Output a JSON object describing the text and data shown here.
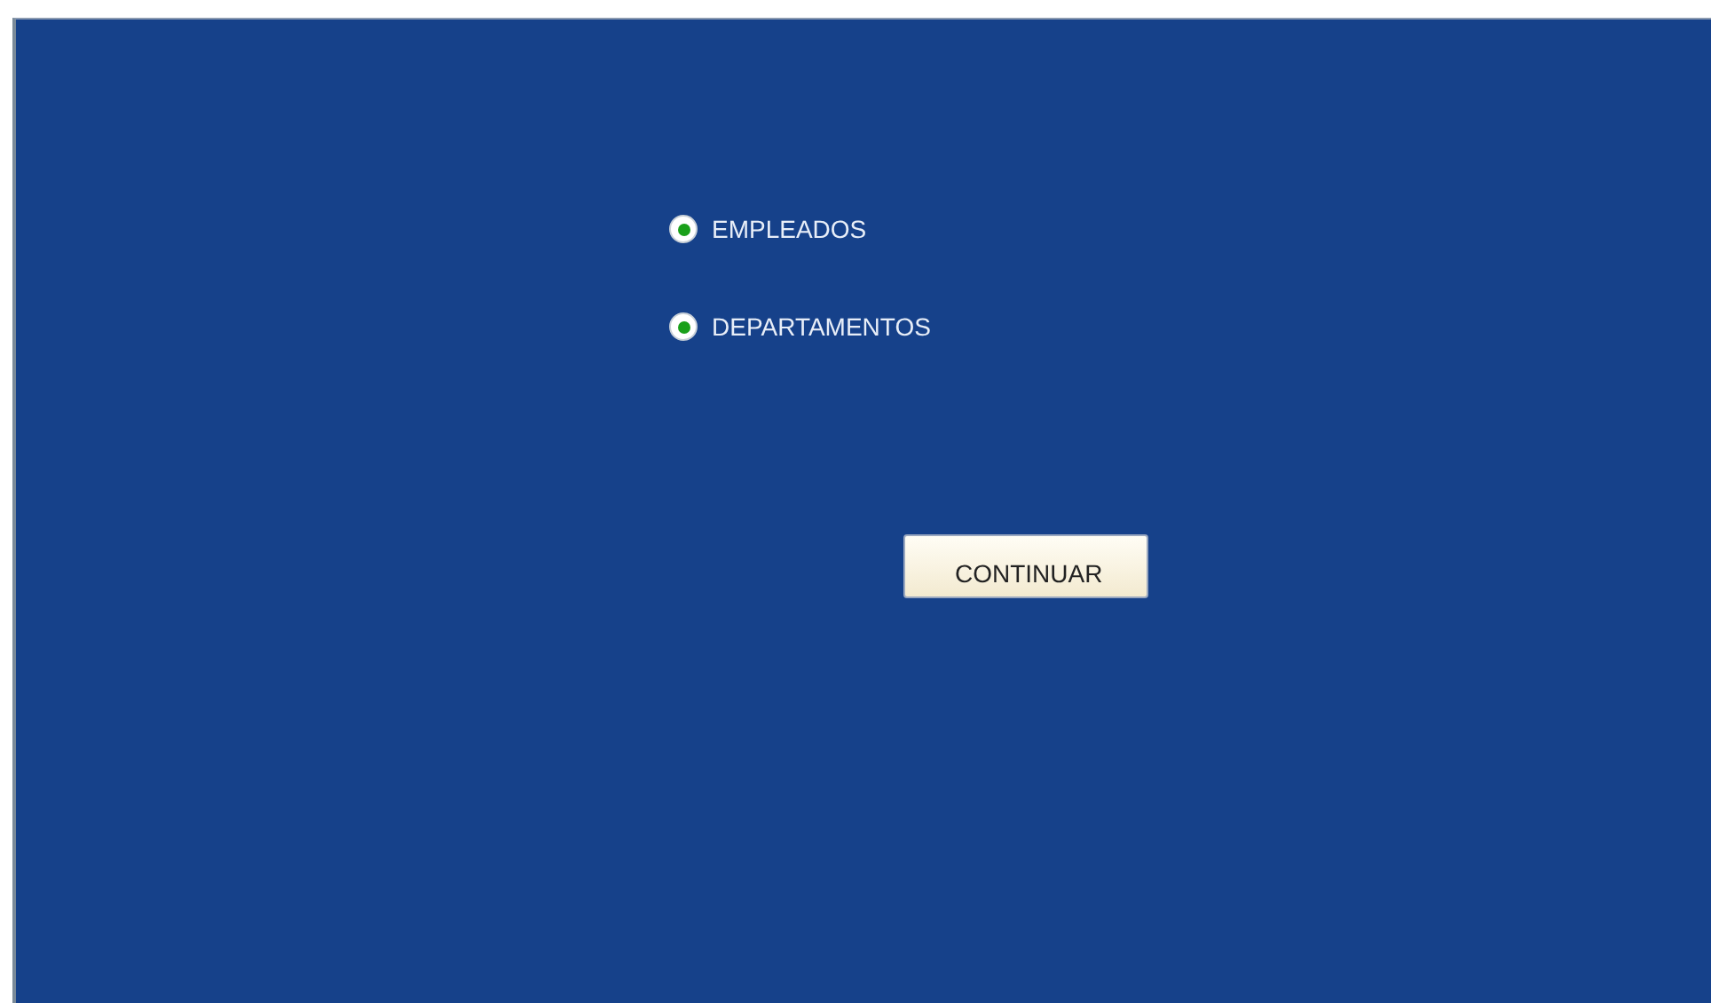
{
  "options": [
    {
      "label": "EMPLEADOS",
      "selected": true
    },
    {
      "label": "DEPARTAMENTOS",
      "selected": true
    }
  ],
  "button": {
    "label": "CONTINUAR"
  }
}
